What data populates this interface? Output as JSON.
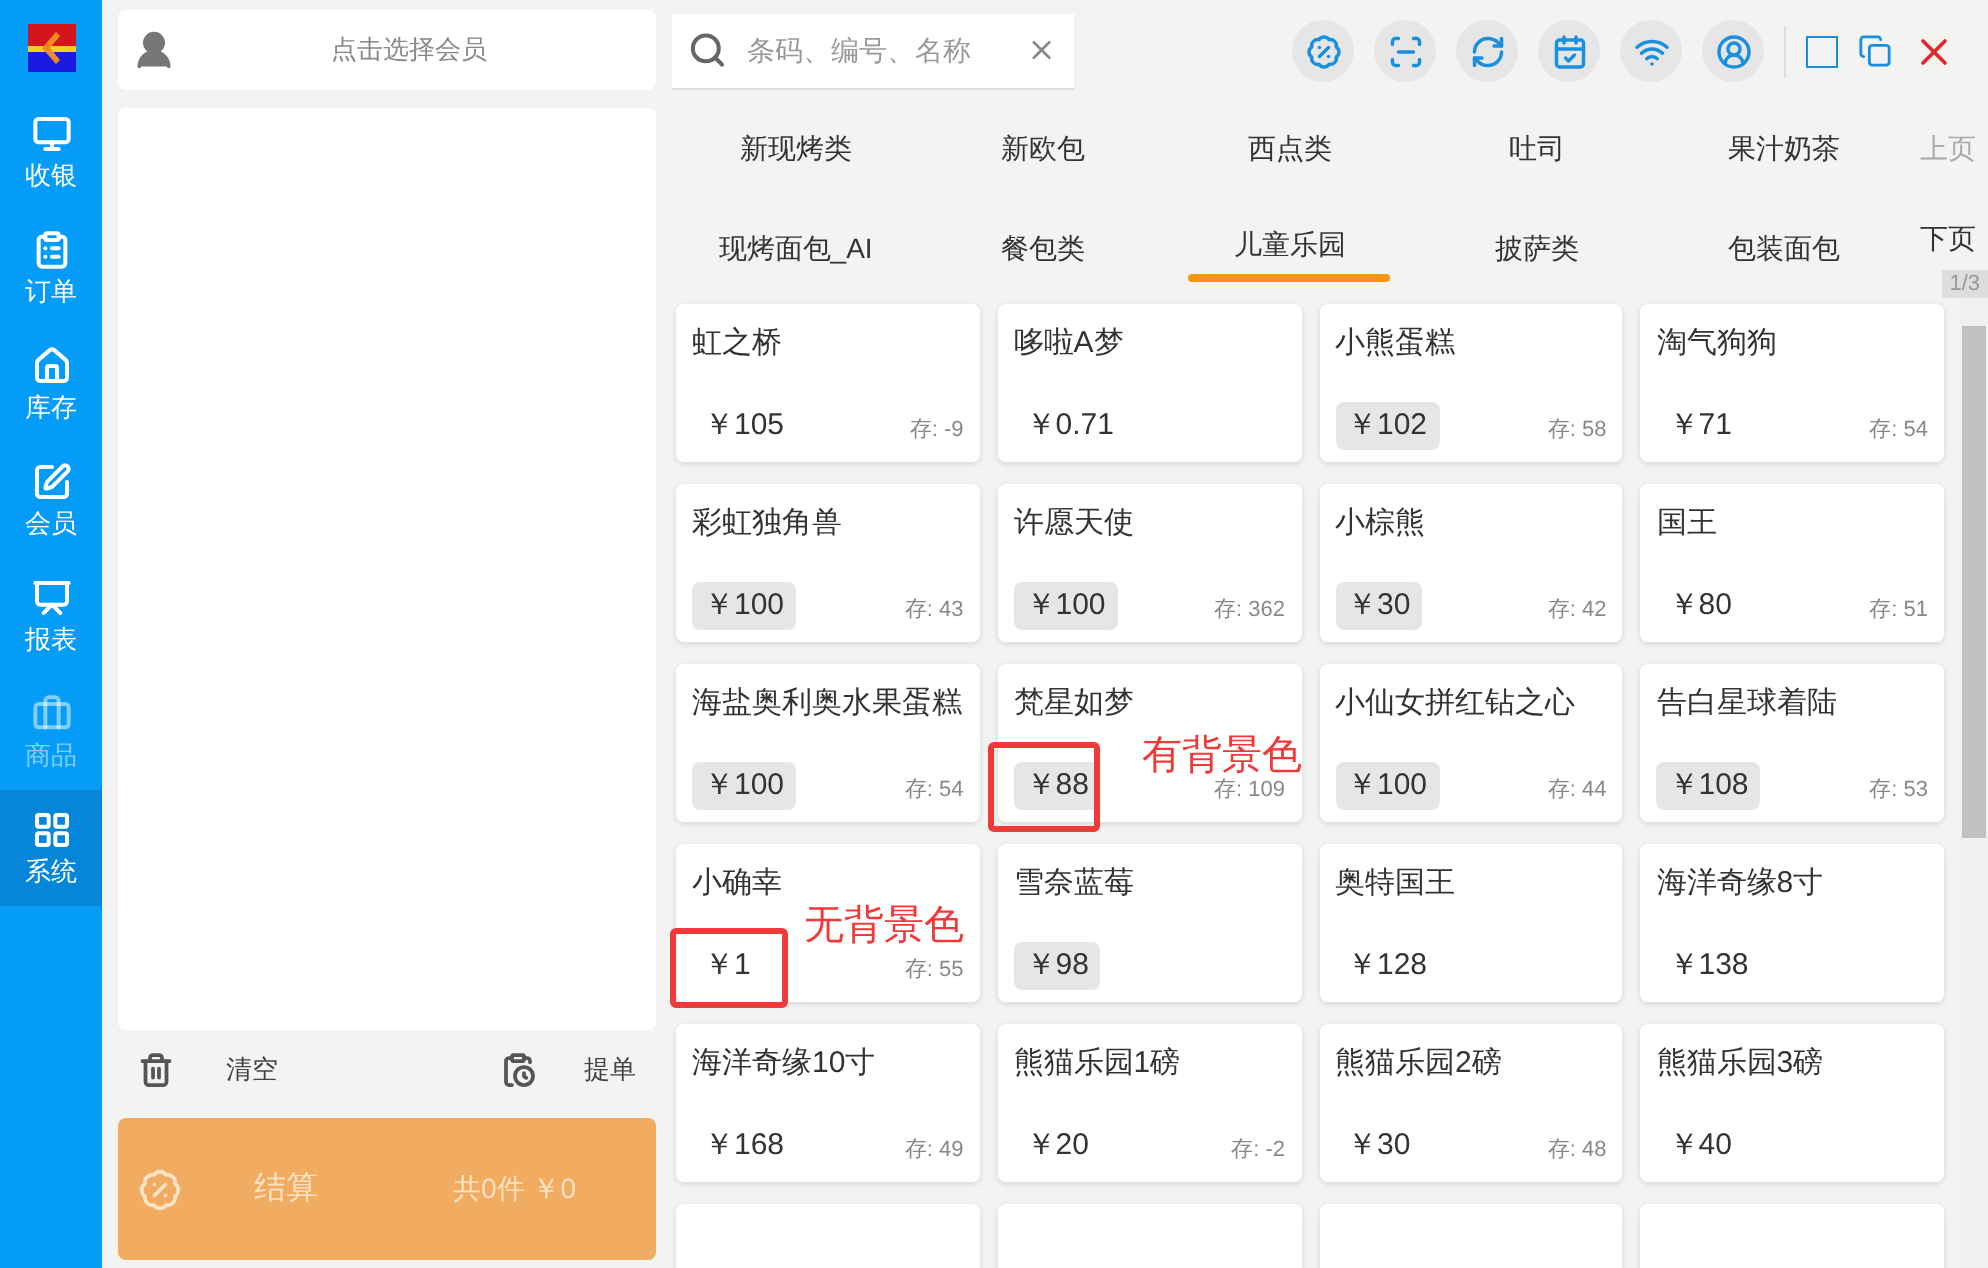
{
  "sidebar": {
    "items": [
      {
        "label": "收银",
        "selected": false,
        "disabled": false
      },
      {
        "label": "订单",
        "selected": false,
        "disabled": false
      },
      {
        "label": "库存",
        "selected": false,
        "disabled": false
      },
      {
        "label": "会员",
        "selected": false,
        "disabled": false
      },
      {
        "label": "报表",
        "selected": false,
        "disabled": false
      },
      {
        "label": "商品",
        "selected": false,
        "disabled": true
      },
      {
        "label": "系统",
        "selected": true,
        "disabled": false
      }
    ]
  },
  "member": {
    "label": "点击选择会员"
  },
  "search": {
    "placeholder": "条码、编号、名称"
  },
  "cart": {
    "clear": "清空",
    "hold": "提单",
    "checkout": {
      "label": "结算",
      "summary": "共0件 ￥0"
    }
  },
  "categories": {
    "rows": [
      [
        {
          "label": "新现烤类",
          "selected": false
        },
        {
          "label": "新欧包",
          "selected": false
        },
        {
          "label": "西点类",
          "selected": false
        },
        {
          "label": "吐司",
          "selected": false
        },
        {
          "label": "果汁奶茶",
          "selected": false
        }
      ],
      [
        {
          "label": "现烤面包_AI",
          "selected": false
        },
        {
          "label": "餐包类",
          "selected": false
        },
        {
          "label": "儿童乐园",
          "selected": true
        },
        {
          "label": "披萨类",
          "selected": false
        },
        {
          "label": "包装面包",
          "selected": false
        }
      ]
    ],
    "prev": {
      "label": "上页",
      "disabled": true
    },
    "next": {
      "label": "下页",
      "disabled": false
    },
    "page": "1/3"
  },
  "products": [
    {
      "name": "虹之桥",
      "price": "￥105",
      "highlighted": false,
      "stock": "存: -9"
    },
    {
      "name": "哆啦A梦",
      "price": "￥0.71",
      "highlighted": false
    },
    {
      "name": "小熊蛋糕",
      "price": "￥102",
      "highlighted": true,
      "stock": "存: 58"
    },
    {
      "name": "淘气狗狗",
      "price": "￥71",
      "highlighted": false,
      "stock": "存: 54"
    },
    {
      "name": "彩虹独角兽",
      "price": "￥100",
      "highlighted": true,
      "stock": "存: 43"
    },
    {
      "name": "许愿天使",
      "price": "￥100",
      "highlighted": true,
      "stock": "存: 362"
    },
    {
      "name": "小棕熊",
      "price": "￥30",
      "highlighted": true,
      "stock": "存: 42"
    },
    {
      "name": "国王",
      "price": "￥80",
      "highlighted": false,
      "stock": "存: 51"
    },
    {
      "name": "海盐奥利奥水果蛋糕",
      "price": "￥100",
      "highlighted": true,
      "stock": "存: 54"
    },
    {
      "name": "梵星如梦",
      "price": "￥88",
      "highlighted": true,
      "stock": "存: 109",
      "annotation": "有背景色"
    },
    {
      "name": "小仙女拼红钻之心",
      "price": "￥100",
      "highlighted": true,
      "stock": "存: 44"
    },
    {
      "name": "告白星球着陆",
      "price": "￥108",
      "highlighted": true,
      "stock": "存: 53"
    },
    {
      "name": "小确幸",
      "price": "￥1",
      "highlighted": false,
      "stock": "存: 55",
      "annotation": "无背景色"
    },
    {
      "name": "雪奈蓝莓",
      "price": "￥98",
      "highlighted": true
    },
    {
      "name": "奥特国王",
      "price": "￥128",
      "highlighted": false
    },
    {
      "name": "海洋奇缘8寸",
      "price": "￥138",
      "highlighted": false
    },
    {
      "name": "海洋奇缘10寸",
      "price": "￥168",
      "highlighted": false,
      "stock": "存: 49"
    },
    {
      "name": "熊猫乐园1磅",
      "price": "￥20",
      "highlighted": false,
      "stock": "存: -2"
    },
    {
      "name": "熊猫乐园2磅",
      "price": "￥30",
      "highlighted": false,
      "stock": "存: 48"
    },
    {
      "name": "熊猫乐园3磅",
      "price": "￥40",
      "highlighted": false
    }
  ]
}
